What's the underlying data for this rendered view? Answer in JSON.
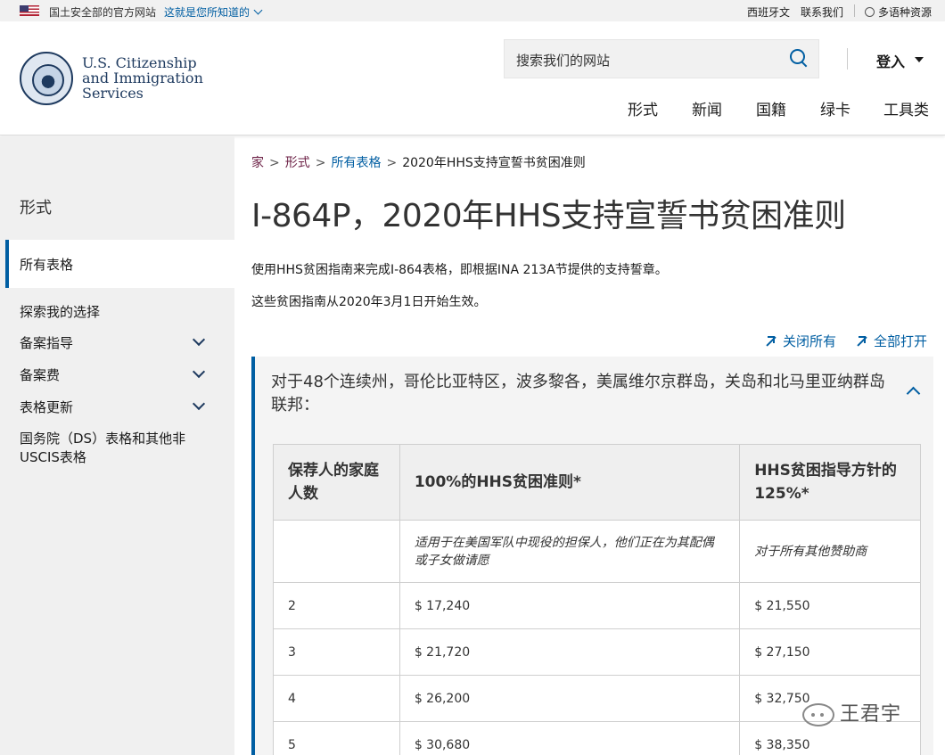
{
  "gov_banner": {
    "official_text": "国土安全部的官方网站",
    "how_you_know": "这就是您所知道的",
    "spanish": "西班牙文",
    "contact": "联系我们",
    "languages": "多语种资源"
  },
  "header": {
    "logo_line1": "U.S. Citizenship",
    "logo_line2": "and Immigration",
    "logo_line3": "Services",
    "search_placeholder": "搜索我们的网站",
    "login": "登入",
    "nav": [
      "形式",
      "新闻",
      "国籍",
      "绿卡",
      "工具类"
    ]
  },
  "sidebar": {
    "title": "形式",
    "active": "所有表格",
    "items": [
      "探索我的选择",
      "备案指导",
      "备案费",
      "表格更新"
    ],
    "multi_item": "国务院（DS）表格和其他非USCIS表格"
  },
  "breadcrumb": {
    "home": "家",
    "forms": "形式",
    "all_forms": "所有表格",
    "current": "2020年HHS支持宣誓书贫困准则"
  },
  "main": {
    "title": "I-864P，2020年HHS支持宣誓书贫困准则",
    "intro1": "使用HHS贫困指南来完成I-864表格，即根据INA 213A节提供的支持誓章。",
    "intro2": "这些贫困指南从2020年3月1日开始生效。",
    "collapse_all": "关闭所有",
    "expand_all": "全部打开"
  },
  "accordion": {
    "heading": "对于48个连续州，哥伦比亚特区，波多黎各，美属维尔京群岛，关岛和北马里亚纳群岛联邦：",
    "table": {
      "headers": [
        "保荐人的家庭人数",
        "100%的HHS贫困准则*",
        "HHS贫困指导方针的125%*"
      ],
      "notes": [
        "",
        "适用于在美国军队中现役的担保人，他们正在为其配偶或子女做请愿",
        "对于所有其他赞助商"
      ],
      "rows": [
        [
          "2",
          "$ 17,240",
          "$ 21,550"
        ],
        [
          "3",
          "$ 21,720",
          "$ 27,150"
        ],
        [
          "4",
          "$ 26,200",
          "$ 32,750"
        ],
        [
          "5",
          "$ 30,680",
          "$ 38,350"
        ]
      ]
    }
  },
  "watermark": "王君宇"
}
